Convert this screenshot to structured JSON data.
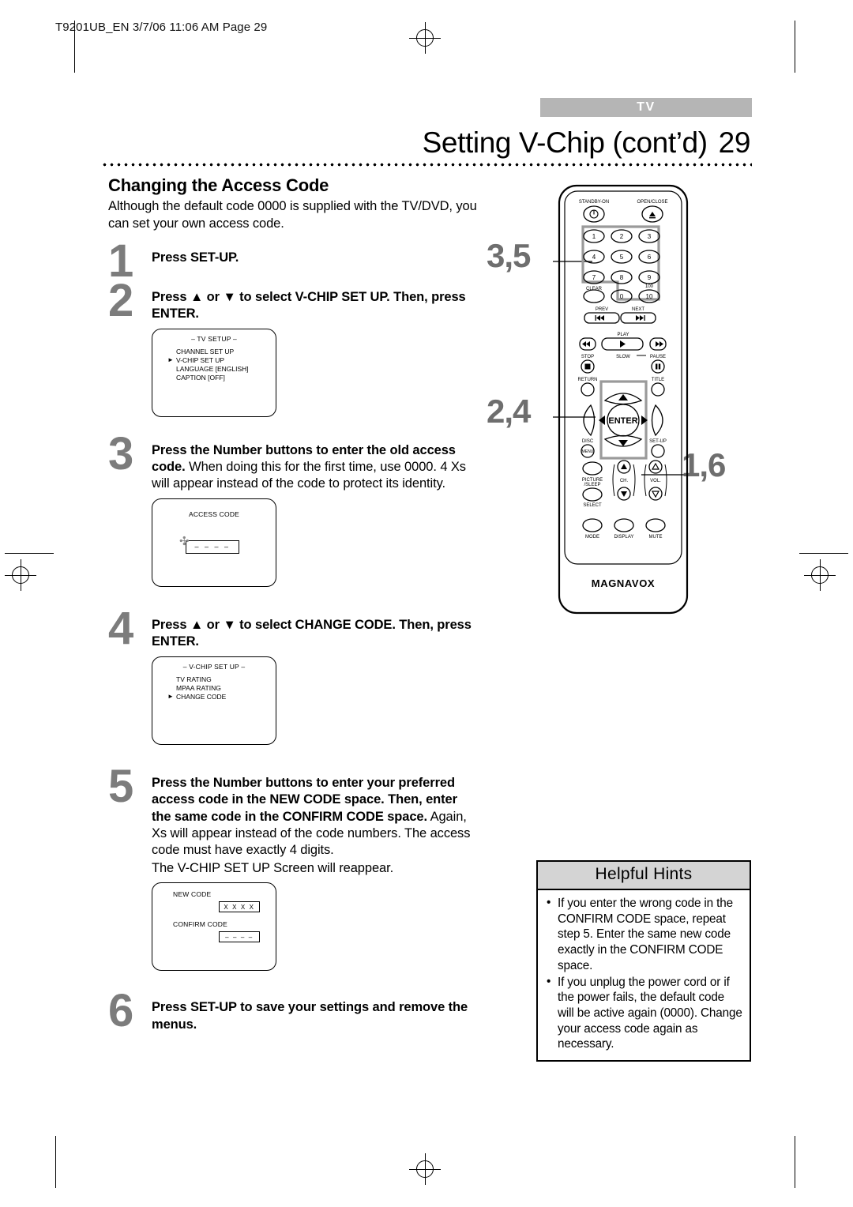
{
  "running_header": "T9201UB_EN 3/7/06 11:06 AM Page 29",
  "header": {
    "banner": "TV",
    "title": "Setting V-Chip (cont’d)",
    "page_number": "29"
  },
  "section": {
    "heading": "Changing the Access Code",
    "intro": "Although the default code 0000 is supplied with the TV/DVD, you can set your own access code."
  },
  "steps": [
    {
      "number": "1",
      "bold_lead": "Press SET-UP.",
      "rest": ""
    },
    {
      "number": "2",
      "bold_lead": "Press ▲ or ▼ to select V-CHIP SET UP. Then, press ENTER.",
      "rest": ""
    },
    {
      "number": "3",
      "bold_lead": "Press the Number buttons to enter the old access code.",
      "rest": " When doing this for the first time, use 0000. 4 Xs will appear instead of the code to protect its identity."
    },
    {
      "number": "4",
      "bold_lead": "Press ▲ or ▼ to select CHANGE CODE. Then, press ENTER.",
      "rest": ""
    },
    {
      "number": "5",
      "bold_lead": "Press the Number buttons to enter your preferred access code in the NEW CODE space. Then, enter the same code in the CONFIRM CODE space.",
      "rest": " Again, Xs will appear instead of the code numbers. The access code must have exactly 4 digits.",
      "extra": "The V-CHIP SET UP Screen will reappear."
    },
    {
      "number": "6",
      "bold_lead": "Press SET-UP to save your settings and remove the menus.",
      "rest": ""
    }
  ],
  "osd_tv_setup": {
    "title": "– TV SETUP –",
    "items": [
      {
        "label": "CHANNEL SET UP",
        "selected": false
      },
      {
        "label": "V-CHIP SET UP",
        "selected": true
      },
      {
        "label": "LANGUAGE  [ENGLISH]",
        "selected": false
      },
      {
        "label": "CAPTION  [OFF]",
        "selected": false
      }
    ]
  },
  "osd_access_code": {
    "title": "ACCESS CODE",
    "field_value": "– – – –"
  },
  "osd_vchip_setup": {
    "title": "– V-CHIP SET UP –",
    "items": [
      {
        "label": "TV RATING",
        "selected": false
      },
      {
        "label": "MPAA RATING",
        "selected": false
      },
      {
        "label": "CHANGE CODE",
        "selected": true
      }
    ]
  },
  "osd_new_code": {
    "new_code_label": "NEW CODE",
    "new_code_value": "X X X X",
    "confirm_code_label": "CONFIRM CODE",
    "confirm_code_value": "– – – –"
  },
  "hints": {
    "title": "Helpful Hints",
    "items": [
      "If you enter the wrong code in the CONFIRM CODE space, repeat step 5. Enter the same new code exactly in the CONFIRM CODE space.",
      "If you unplug the power cord or if the power fails, the default code will be active again (0000). Change your access code again as necessary."
    ]
  },
  "callouts": [
    {
      "label": "3,5"
    },
    {
      "label": "2,4"
    },
    {
      "label": "1,6"
    }
  ],
  "remote": {
    "brand": "MAGNAVOX",
    "standby_label": "STANDBY-ON",
    "open_close_label": "OPEN/CLOSE",
    "keys": [
      "1",
      "2",
      "3",
      "4",
      "5",
      "6",
      "7",
      "8",
      "9"
    ],
    "clear_label": "CLEAR",
    "zero_label": "0",
    "hundred_label": "100",
    "ten_label": "10",
    "prev_label": "PREV",
    "next_label": "NEXT",
    "play_label": "PLAY",
    "stop_label": "STOP",
    "slow_label": "SLOW",
    "pause_label": "PAUSE",
    "return_label": "RETURN",
    "title_label": "TITLE",
    "enter_label": "ENTER",
    "disc_label": "DISC",
    "disc_sub_label": "MENU",
    "setup_label": "SET-UP",
    "picture_label": "PICTURE",
    "sleep_label": "/SLEEP",
    "select_label": "SELECT",
    "ch_label": "CH.",
    "vol_label": "VOL.",
    "mode_label": "MODE",
    "display_label": "DISPLAY",
    "mute_label": "MUTE"
  }
}
